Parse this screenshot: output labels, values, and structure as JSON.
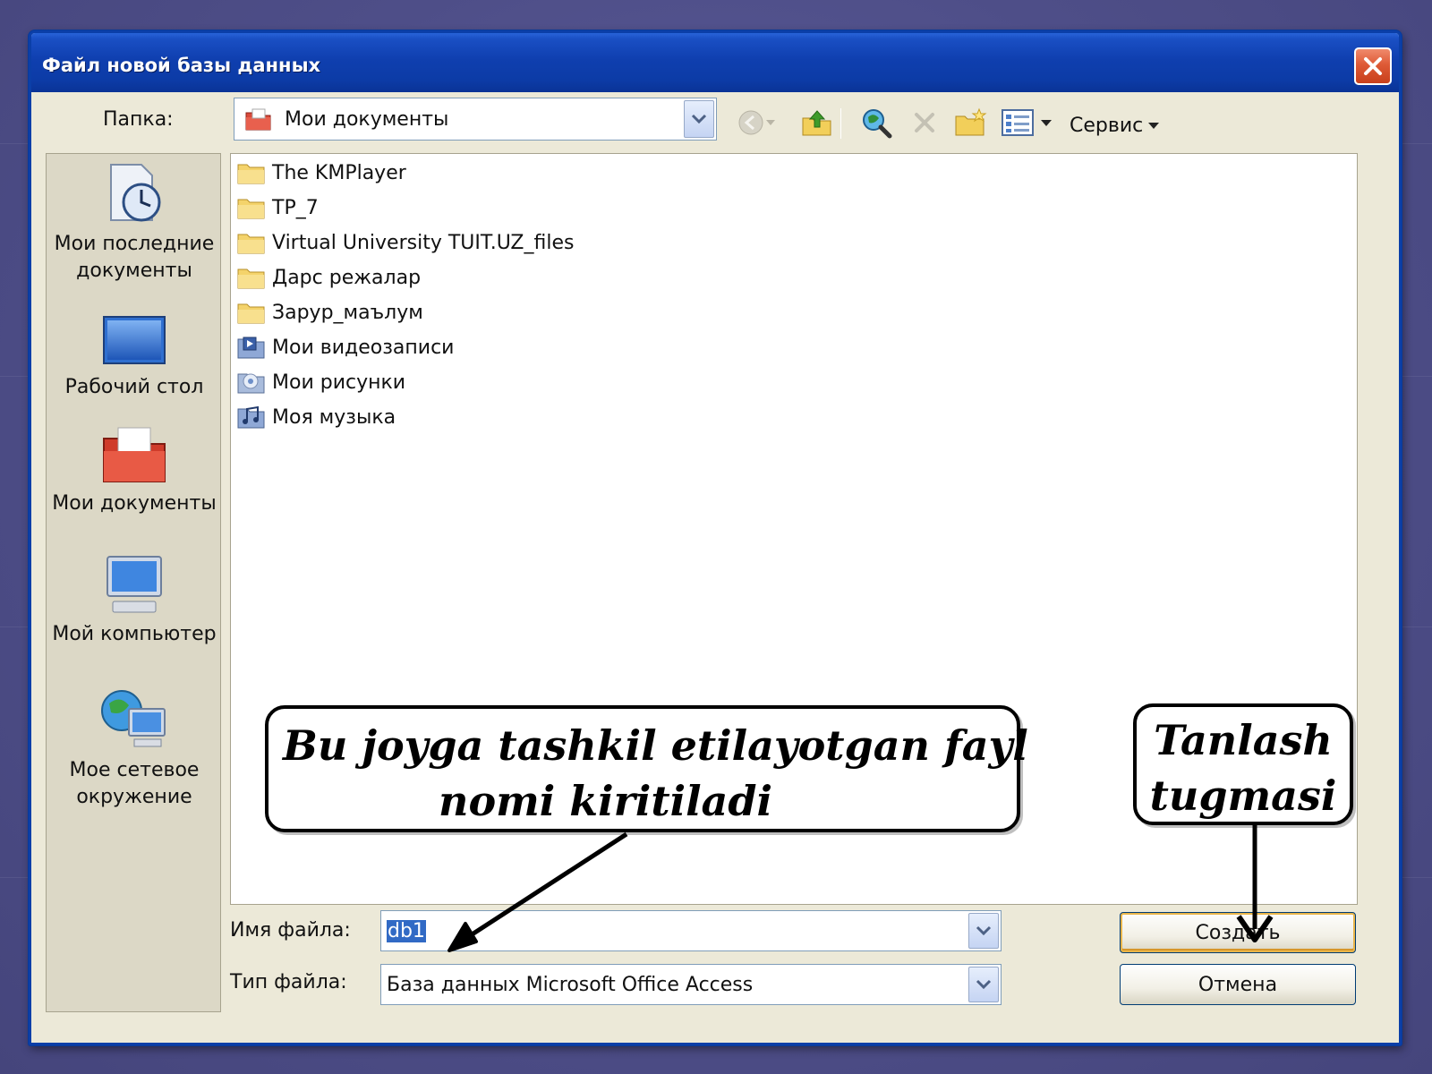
{
  "window": {
    "title": "Файл новой базы данных"
  },
  "toolbar": {
    "folder_label": "Папка:",
    "folder_value": "Мои документы",
    "service_label": "Сервис"
  },
  "places": [
    {
      "label": "Мои последние документы",
      "icon": "recent-documents-icon"
    },
    {
      "label": "Рабочий стол",
      "icon": "desktop-icon"
    },
    {
      "label": "Мои документы",
      "icon": "my-documents-icon"
    },
    {
      "label": "Мой компьютер",
      "icon": "my-computer-icon"
    },
    {
      "label": "Мое сетевое окружение",
      "icon": "network-places-icon"
    }
  ],
  "files": [
    {
      "name": "The KMPlayer",
      "icon": "folder-icon"
    },
    {
      "name": "TP_7",
      "icon": "folder-icon"
    },
    {
      "name": "Virtual University TUIT.UZ_files",
      "icon": "folder-icon"
    },
    {
      "name": "Дарс режалар",
      "icon": "folder-icon"
    },
    {
      "name": "Зарур_маълум",
      "icon": "folder-icon"
    },
    {
      "name": "Мои видеозаписи",
      "icon": "video-folder-icon"
    },
    {
      "name": "Мои рисунки",
      "icon": "pictures-folder-icon"
    },
    {
      "name": "Моя музыка",
      "icon": "music-folder-icon"
    }
  ],
  "form": {
    "filename_label": "Имя файла:",
    "filename_value": "db1",
    "filetype_label": "Тип файла:",
    "filetype_value": "База данных Microsoft Office Access"
  },
  "buttons": {
    "create_label": "Создать",
    "cancel_label": "Отмена"
  },
  "annotations": {
    "filename_callout_line1": "Bu joyga tashkil etilayotgan fayl",
    "filename_callout_line2": "nomi kiritiladi",
    "button_callout_line1": "Tanlash",
    "button_callout_line2": "tugmasi"
  }
}
